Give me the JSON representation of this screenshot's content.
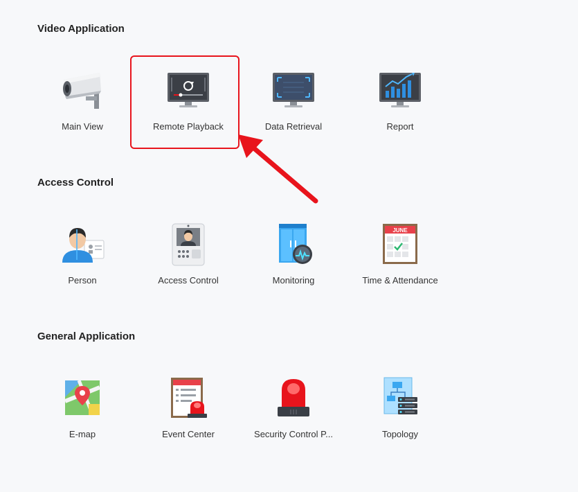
{
  "sections": [
    {
      "title": "Video Application",
      "items": [
        {
          "label": "Main View",
          "icon": "camera-icon"
        },
        {
          "label": "Remote Playback",
          "icon": "playback-monitor-icon"
        },
        {
          "label": "Data Retrieval",
          "icon": "retrieval-monitor-icon"
        },
        {
          "label": "Report",
          "icon": "report-chart-icon"
        }
      ]
    },
    {
      "title": "Access Control",
      "items": [
        {
          "label": "Person",
          "icon": "person-card-icon"
        },
        {
          "label": "Access Control",
          "icon": "door-intercom-icon"
        },
        {
          "label": "Monitoring",
          "icon": "door-monitoring-icon"
        },
        {
          "label": "Time & Attendance",
          "icon": "calendar-icon"
        }
      ]
    },
    {
      "title": "General Application",
      "items": [
        {
          "label": "E-map",
          "icon": "map-pin-icon"
        },
        {
          "label": "Event Center",
          "icon": "event-alarm-icon"
        },
        {
          "label": "Security Control P...",
          "icon": "siren-icon"
        },
        {
          "label": "Topology",
          "icon": "topology-icon"
        }
      ]
    }
  ],
  "calendar_month": "JUNE",
  "colors": {
    "highlight": "#e8141c",
    "background": "#f7f8fa"
  }
}
